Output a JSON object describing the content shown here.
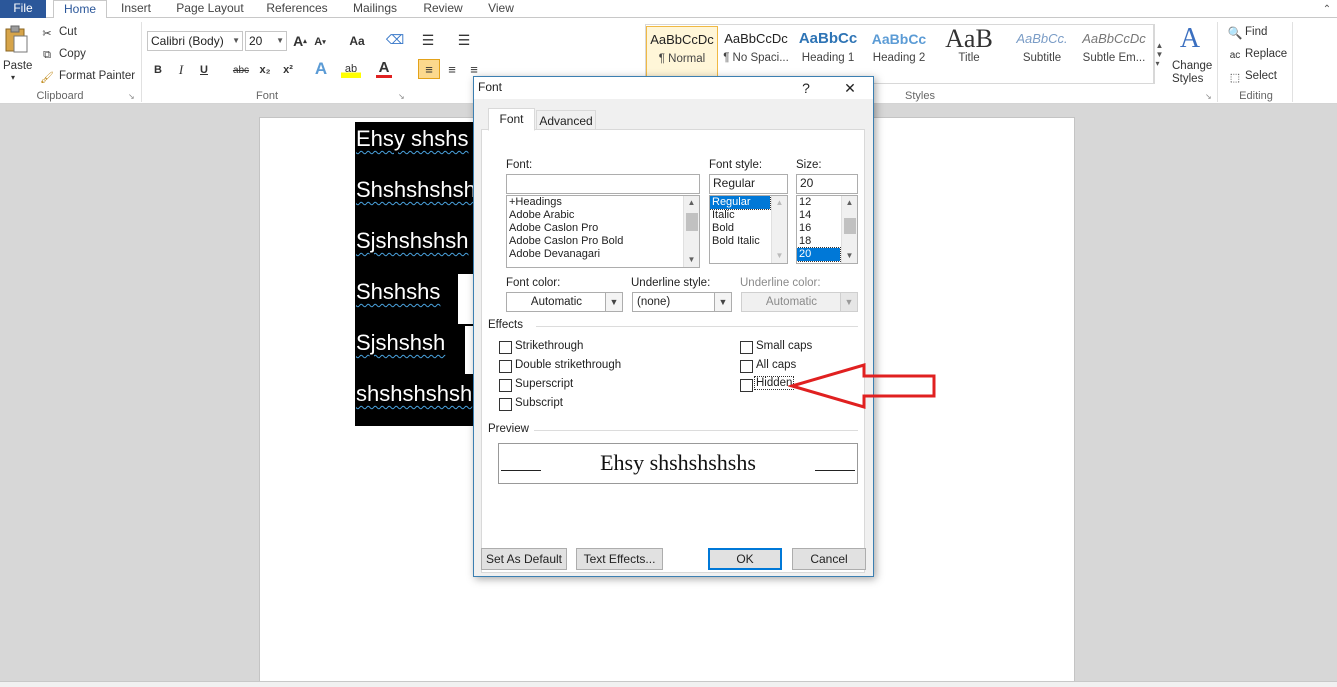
{
  "tabs": [
    "File",
    "Home",
    "Insert",
    "Page Layout",
    "References",
    "Mailings",
    "Review",
    "View"
  ],
  "clipboard": {
    "paste": "Paste",
    "cut": "Cut",
    "copy": "Copy",
    "format_painter": "Format Painter",
    "group": "Clipboard"
  },
  "font_group": {
    "font_name": "Calibri (Body)",
    "font_size": "20",
    "group": "Font",
    "bold": "B",
    "italic": "I",
    "underline": "U",
    "strike": "abc",
    "sub": "x₂",
    "sup": "x²",
    "grow": "A",
    "shrink": "A",
    "case": "Aa",
    "color_a": "A"
  },
  "styles": {
    "items": [
      {
        "sample": "AaBbCcDc",
        "name": "¶ Normal"
      },
      {
        "sample": "AaBbCcDc",
        "name": "¶ No Spaci..."
      },
      {
        "sample": "AaBbCc",
        "name": "Heading 1"
      },
      {
        "sample": "AaBbCc",
        "name": "Heading 2"
      },
      {
        "sample": "AaB",
        "name": "Title"
      },
      {
        "sample": "AaBbCc.",
        "name": "Subtitle"
      },
      {
        "sample": "AaBbCcDc",
        "name": "Subtle Em..."
      }
    ],
    "change_styles_1": "Change",
    "change_styles_2": "Styles",
    "group": "Styles"
  },
  "editing": {
    "find": "Find",
    "replace": "Replace",
    "select": "Select",
    "group": "Editing"
  },
  "document": {
    "lines": [
      "Ehsy shshs",
      "Shshshshsh",
      "Sjshshshsh",
      "Shshshs",
      "Sjshshsh",
      "shshshshsh"
    ]
  },
  "dialog": {
    "title": "Font",
    "help": "?",
    "close": "✕",
    "tabs": [
      "Font",
      "Advanced"
    ],
    "font_label": "Font:",
    "font_value": "",
    "font_list": [
      "+Headings",
      "Adobe Arabic",
      "Adobe Caslon Pro",
      "Adobe Caslon Pro Bold",
      "Adobe Devanagari"
    ],
    "style_label": "Font style:",
    "style_value": "Regular",
    "style_list": [
      "Regular",
      "Italic",
      "Bold",
      "Bold Italic"
    ],
    "size_label": "Size:",
    "size_value": "20",
    "size_list": [
      "12",
      "14",
      "16",
      "18",
      "20"
    ],
    "font_color_label": "Font color:",
    "font_color_value": "Automatic",
    "underline_style_label": "Underline style:",
    "underline_style_value": "(none)",
    "underline_color_label": "Underline color:",
    "underline_color_value": "Automatic",
    "effects_label": "Effects",
    "effects_left": [
      "Strikethrough",
      "Double strikethrough",
      "Superscript",
      "Subscript"
    ],
    "effects_right": [
      "Small caps",
      "All caps",
      "Hidden"
    ],
    "preview_label": "Preview",
    "preview_text": "Ehsy shshshshshs",
    "set_default": "Set As Default",
    "text_effects": "Text Effects...",
    "ok": "OK",
    "cancel": "Cancel"
  },
  "colors": {
    "accent": "#2b579a",
    "selection": "#0078d7",
    "arrow": "#e02020"
  }
}
